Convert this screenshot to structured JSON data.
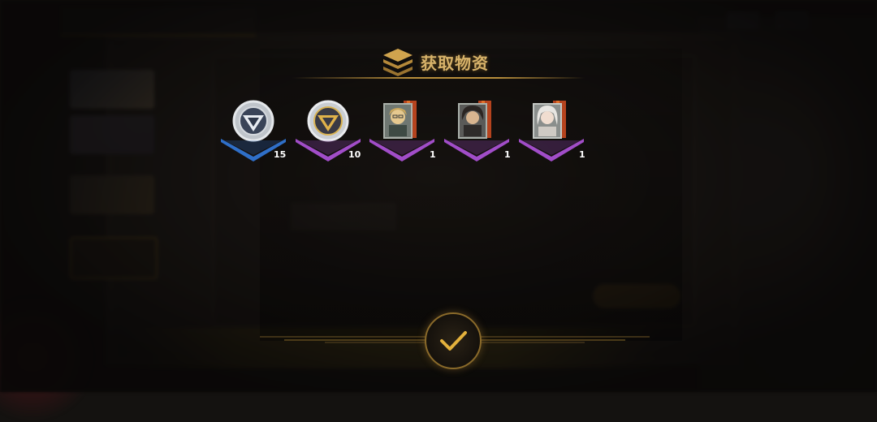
{
  "dialog": {
    "title": "获取物资",
    "title_icon": "stacked-layers-icon",
    "accent_color": "#d8b36a"
  },
  "rewards": [
    {
      "icon": "silver-token-icon",
      "rarity": "blue",
      "quantity": "15"
    },
    {
      "icon": "gold-token-icon",
      "rarity": "purple",
      "quantity": "10"
    },
    {
      "icon": "character-dossier-icon",
      "rarity": "purple",
      "quantity": "1"
    },
    {
      "icon": "character-dossier-icon",
      "rarity": "purple",
      "quantity": "1"
    },
    {
      "icon": "character-dossier-icon",
      "rarity": "purple",
      "quantity": "1"
    }
  ],
  "confirm": {
    "icon": "checkmark-icon"
  },
  "colors": {
    "blue_rarity": "#2f6fc8",
    "purple_rarity": "#a14dc8",
    "gold": "#c8952e"
  }
}
